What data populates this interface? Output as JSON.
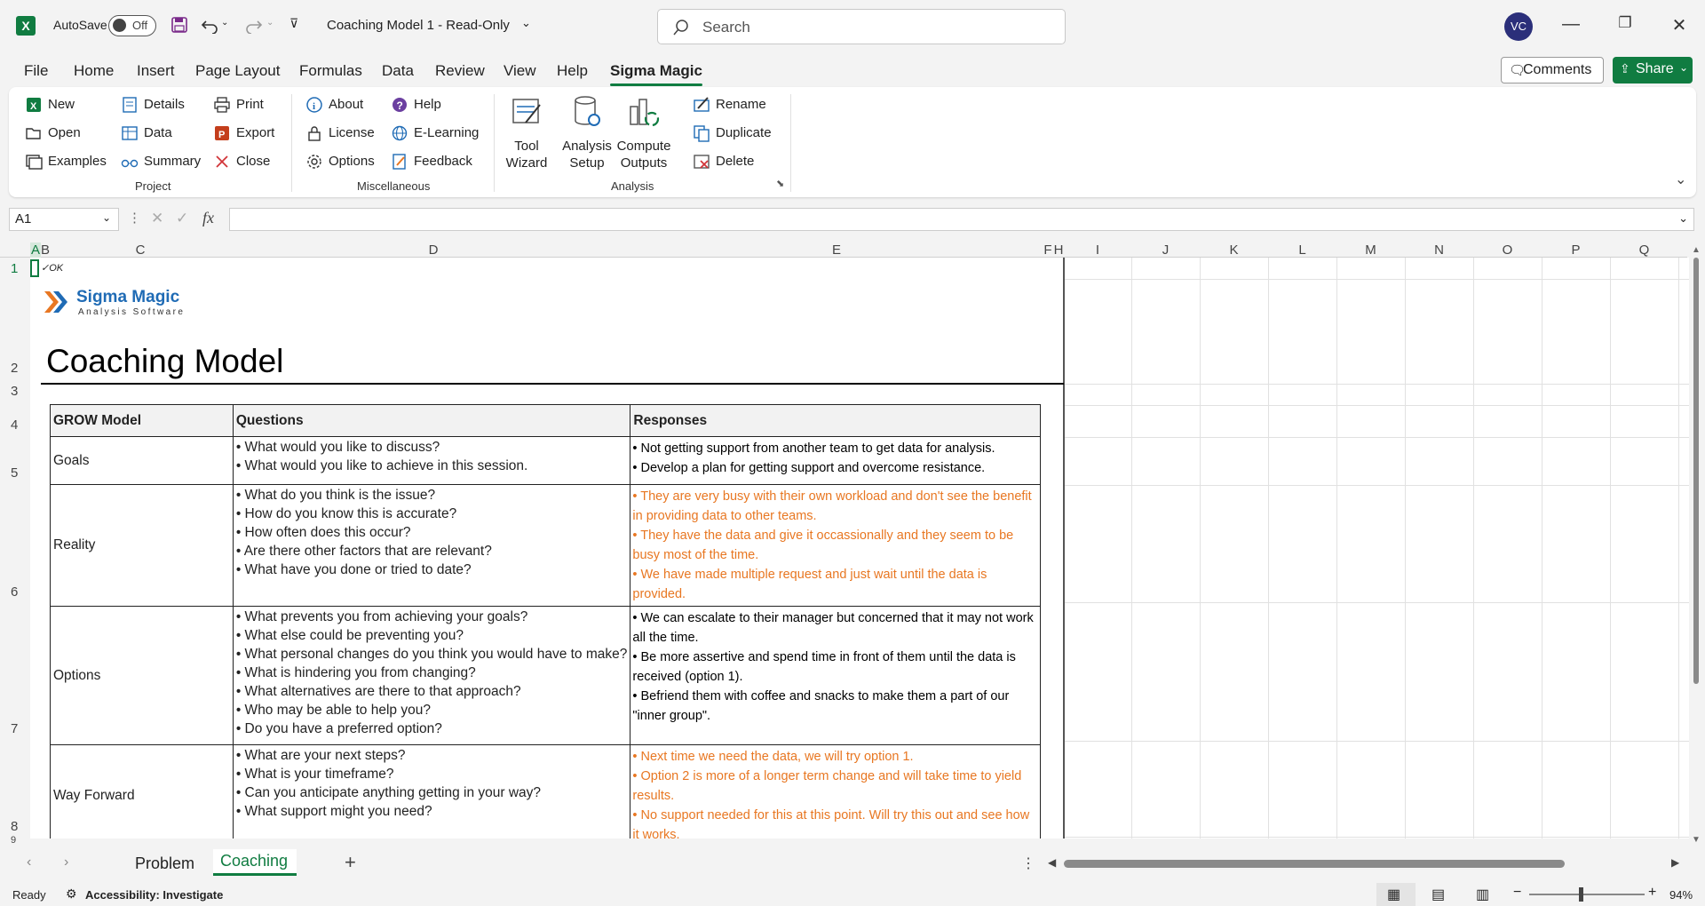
{
  "titlebar": {
    "app_icon": "excel-icon",
    "autosave_label": "AutoSave",
    "autosave_state": "Off",
    "doc_title": "Coaching Model 1  -  Read-Only",
    "search_placeholder": "Search",
    "avatar_initials": "VC"
  },
  "menu": {
    "tabs": [
      "File",
      "Home",
      "Insert",
      "Page Layout",
      "Formulas",
      "Data",
      "Review",
      "View",
      "Help",
      "Sigma Magic"
    ],
    "active": "Sigma Magic",
    "comments_label": "Comments",
    "share_label": "Share"
  },
  "ribbon": {
    "project": {
      "label": "Project",
      "buttons": [
        "New",
        "Open",
        "Examples",
        "Details",
        "Data",
        "Summary",
        "Print",
        "Export",
        "Close"
      ]
    },
    "misc": {
      "label": "Miscellaneous",
      "buttons": [
        "About",
        "License",
        "Options",
        "Help",
        "E-Learning",
        "Feedback"
      ]
    },
    "analysis": {
      "label": "Analysis",
      "big_buttons": [
        "Tool\nWizard",
        "Analysis\nSetup",
        "Compute\nOutputs"
      ],
      "buttons": [
        "Rename",
        "Duplicate",
        "Delete"
      ]
    }
  },
  "formula_bar": {
    "name_box": "A1",
    "fx": "fx",
    "content": ""
  },
  "grid": {
    "columns": [
      "A",
      "B",
      "C",
      "D",
      "E",
      "F",
      "H",
      "I",
      "J",
      "K",
      "L",
      "M",
      "N",
      "O",
      "P",
      "Q"
    ],
    "rows": [
      "1",
      "2",
      "3",
      "4",
      "5",
      "6",
      "7",
      "8",
      "9"
    ]
  },
  "sheet": {
    "ok_mark": "✓OK",
    "logo_title": "Sigma Magic",
    "logo_subtitle": "Analysis Software",
    "title": "Coaching Model",
    "table": {
      "headers": [
        "GROW Model",
        "Questions",
        "Responses"
      ],
      "rows": [
        {
          "model": "Goals",
          "questions": [
            "• What would you like to discuss?",
            "• What would you like to achieve in this session."
          ],
          "responses": [
            "• Not getting support from another team to get data for analysis.",
            "• Develop a plan for getting support and overcome resistance."
          ],
          "response_color": "#000000"
        },
        {
          "model": "Reality",
          "questions": [
            "• What do you think is the issue?",
            "• How do you know this is accurate?",
            "• How often does this occur?",
            "• Are there other factors that are relevant?",
            "• What have you done or tried to date?"
          ],
          "responses": [
            "• They are very busy with their own workload and don't see the benefit in providing data to other teams.",
            "• They have the data and give it occassionally and they seem to be busy most of the time.",
            "• We have made multiple request and just wait until the data is provided."
          ],
          "response_color": "#e87722"
        },
        {
          "model": "Options",
          "questions": [
            "• What prevents you from achieving your goals?",
            "• What else could be preventing you?",
            "• What personal changes do you think you would have to make?",
            "• What is hindering you from changing?",
            "• What alternatives are there to that approach?",
            "• Who may be able to help you?",
            "• Do you have a preferred option?"
          ],
          "responses": [
            "• We can escalate to their manager but concerned that it may not work all the time.",
            "• Be more assertive and spend time in front of them until the data is received (option 1).",
            "• Befriend them with coffee and snacks to make them a part of our \"inner group\"."
          ],
          "response_color": "#000000"
        },
        {
          "model": "Way Forward",
          "questions": [
            "• What are your next steps?",
            "• What is your timeframe?",
            "• Can you anticipate anything getting in your way?",
            "• What support might you need?"
          ],
          "responses": [
            "• Next time we need the data, we will try option 1.",
            "• Option 2 is more of a longer term change and will take time to yield results.",
            "• No support needed for this at this point. Will try this out and see how it works."
          ],
          "response_color": "#e87722"
        }
      ]
    }
  },
  "sheet_tabs": {
    "tabs": [
      "Problem",
      "Coaching"
    ],
    "active": "Coaching",
    "add": "+"
  },
  "status": {
    "ready": "Ready",
    "accessibility": "Accessibility: Investigate",
    "zoom": "94%"
  },
  "colors": {
    "accent": "#107c41",
    "orange": "#e87722",
    "logo_blue": "#1f6bb5"
  }
}
